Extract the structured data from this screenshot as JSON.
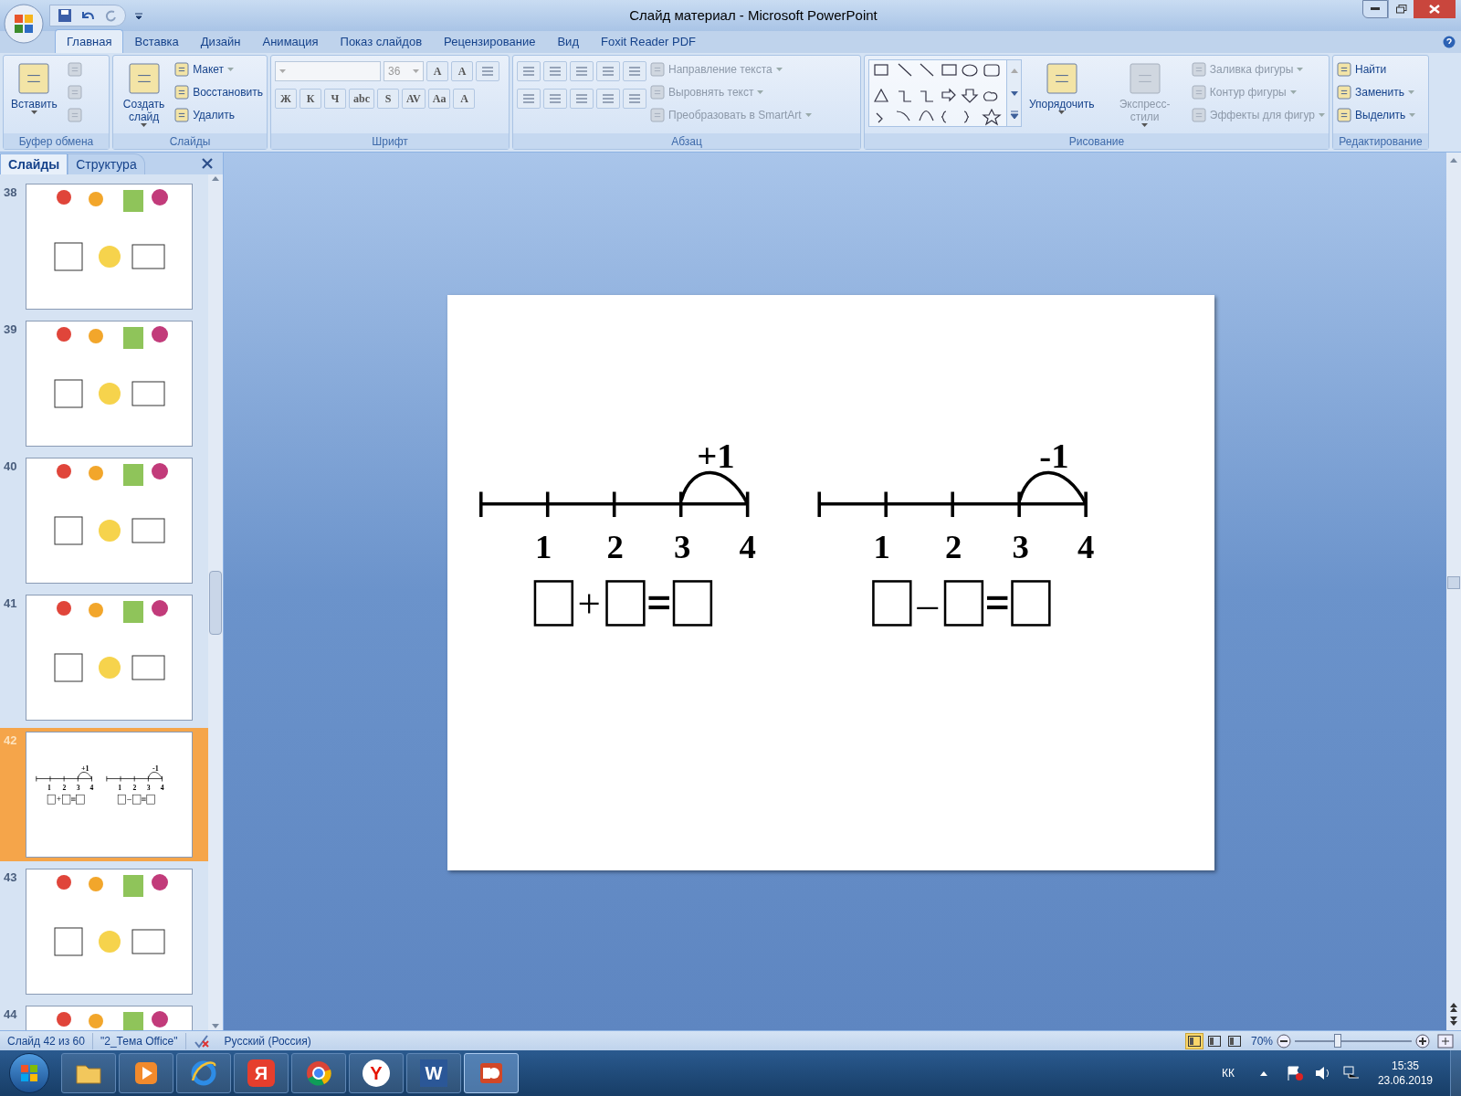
{
  "window": {
    "title": "Слайд материал - Microsoft PowerPoint"
  },
  "tabs": [
    {
      "label": "Главная",
      "selected": true
    },
    {
      "label": "Вставка",
      "selected": false
    },
    {
      "label": "Дизайн",
      "selected": false
    },
    {
      "label": "Анимация",
      "selected": false
    },
    {
      "label": "Показ слайдов",
      "selected": false
    },
    {
      "label": "Рецензирование",
      "selected": false
    },
    {
      "label": "Вид",
      "selected": false
    },
    {
      "label": "Foxit Reader PDF",
      "selected": false
    }
  ],
  "ribbon": [
    {
      "label": "Буфер обмена",
      "columns": [
        [
          {
            "kind": "large",
            "label": "Вставить",
            "disabled": false,
            "dropdown": true
          }
        ],
        [
          {
            "kind": "icon",
            "disabled": true
          },
          {
            "kind": "icon",
            "disabled": true
          },
          {
            "kind": "icon",
            "disabled": true
          }
        ]
      ]
    },
    {
      "label": "Слайды",
      "columns": [
        [
          {
            "kind": "large",
            "label": "Создать слайд",
            "disabled": false,
            "dropdown": true
          }
        ],
        [
          {
            "kind": "small",
            "label": "Макет",
            "disabled": false,
            "dropdown": true
          },
          {
            "kind": "small",
            "label": "Восстановить",
            "disabled": false,
            "dropdown": false
          },
          {
            "kind": "small",
            "label": "Удалить",
            "disabled": false,
            "dropdown": false
          }
        ]
      ]
    },
    {
      "label": "Шрифт",
      "columns": [
        [
          {
            "kind": "toolrow",
            "tools": [
              {
                "kind": "combo"
              },
              {
                "kind": "combo",
                "value": "36"
              },
              {
                "kind": "text",
                "text": "A"
              },
              {
                "kind": "text",
                "text": "A"
              },
              {
                "kind": "icon"
              }
            ]
          },
          {
            "kind": "toolrow",
            "tools": [
              {
                "kind": "text",
                "text": "Ж"
              },
              {
                "kind": "text",
                "text": "К"
              },
              {
                "kind": "text",
                "text": "Ч"
              },
              {
                "kind": "text",
                "text": "abc"
              },
              {
                "kind": "text",
                "text": "S"
              },
              {
                "kind": "text",
                "text": "AV"
              },
              {
                "kind": "text",
                "text": "Aa"
              },
              {
                "kind": "text",
                "text": "A"
              }
            ]
          }
        ]
      ]
    },
    {
      "label": "Абзац",
      "columns": [
        [
          {
            "kind": "toolrow",
            "tools": [
              {
                "kind": "icon"
              },
              {
                "kind": "icon"
              },
              {
                "kind": "icon"
              },
              {
                "kind": "icon"
              },
              {
                "kind": "icon"
              }
            ]
          },
          {
            "kind": "toolrow",
            "tools": [
              {
                "kind": "icon"
              },
              {
                "kind": "icon"
              },
              {
                "kind": "icon"
              },
              {
                "kind": "icon"
              },
              {
                "kind": "icon"
              }
            ]
          }
        ],
        [
          {
            "kind": "small",
            "label": "Направление текста",
            "disabled": true,
            "dropdown": true
          },
          {
            "kind": "small",
            "label": "Выровнять текст",
            "disabled": true,
            "dropdown": true
          },
          {
            "kind": "small",
            "label": "Преобразовать в SmartArt",
            "disabled": true,
            "dropdown": true
          }
        ]
      ]
    },
    {
      "label": "Рисование",
      "columns": [
        [
          {
            "kind": "gallery"
          }
        ],
        [
          {
            "kind": "large",
            "label": "Упорядочить",
            "disabled": false,
            "dropdown": true
          }
        ],
        [
          {
            "kind": "large",
            "label": "Экспресс-стили",
            "disabled": true,
            "dropdown": true
          }
        ],
        [
          {
            "kind": "small",
            "label": "Заливка фигуры",
            "disabled": true,
            "dropdown": true
          },
          {
            "kind": "small",
            "label": "Контур фигуры",
            "disabled": true,
            "dropdown": true
          },
          {
            "kind": "small",
            "label": "Эффекты для фигур",
            "disabled": true,
            "dropdown": true
          }
        ]
      ]
    },
    {
      "label": "Редактирование",
      "columns": [
        [
          {
            "kind": "small",
            "label": "Найти",
            "disabled": false,
            "dropdown": false
          },
          {
            "kind": "small",
            "label": "Заменить",
            "disabled": false,
            "dropdown": true
          },
          {
            "kind": "small",
            "label": "Выделить",
            "disabled": false,
            "dropdown": true
          }
        ]
      ]
    }
  ],
  "panel": {
    "tabs": [
      {
        "label": "Слайды",
        "selected": true
      },
      {
        "label": "Структура",
        "selected": false
      }
    ],
    "thumbnails": [
      {
        "number": "38",
        "selected": false
      },
      {
        "number": "39",
        "selected": false
      },
      {
        "number": "40",
        "selected": false
      },
      {
        "number": "41",
        "selected": false
      },
      {
        "number": "42",
        "selected": true,
        "preview": {
          "number_lines": [
            {
              "step": "+1",
              "ticks": [
                "1",
                "2",
                "3",
                "4"
              ],
              "operator": "+"
            },
            {
              "step": "-1",
              "ticks": [
                "1",
                "2",
                "3",
                "4"
              ],
              "operator": "–"
            }
          ]
        }
      },
      {
        "number": "43",
        "selected": false
      },
      {
        "number": "44",
        "selected": false
      }
    ]
  },
  "slide": {
    "number_lines": [
      {
        "step": "+1",
        "ticks": [
          "1",
          "2",
          "3",
          "4"
        ],
        "operator": "+"
      },
      {
        "step": "-1",
        "ticks": [
          "1",
          "2",
          "3",
          "4"
        ],
        "operator": "–"
      }
    ]
  },
  "status_bar": {
    "slide": "Слайд 42 из 60",
    "theme": "\"2_Тема Office\"",
    "language": "Русский (Россия)",
    "views": [
      {
        "selected": true
      },
      {
        "selected": false
      },
      {
        "selected": false
      }
    ],
    "zoom": "70%",
    "zoom_level": {
      "level": 0.37
    }
  },
  "taskbar": {
    "apps": [
      {
        "kind": "folder",
        "selected": false
      },
      {
        "kind": "player",
        "selected": false
      },
      {
        "kind": "ie",
        "selected": false
      },
      {
        "kind": "yandex",
        "text": "Я",
        "selected": false
      },
      {
        "kind": "chrome",
        "selected": false
      },
      {
        "kind": "ybrowser",
        "text": "Y",
        "selected": false
      },
      {
        "kind": "word",
        "text": "W",
        "selected": false
      },
      {
        "kind": "powerpoint",
        "selected": true
      }
    ],
    "language": "КК",
    "time": "15:35",
    "date": "23.06.2019"
  }
}
